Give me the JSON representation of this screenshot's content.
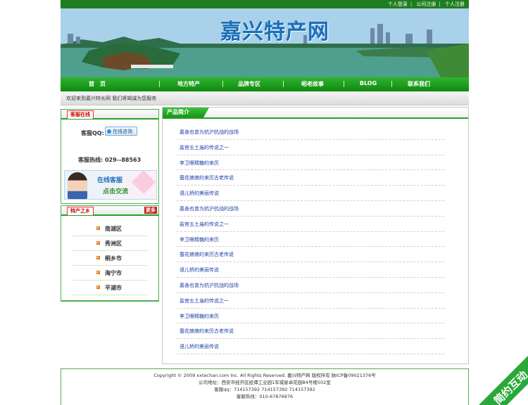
{
  "top_links": [
    "个人登录",
    "公司注册",
    "个人注册"
  ],
  "banner": {
    "title": "嘉兴特产网"
  },
  "nav": {
    "items": [
      "首　页",
      "地方特产",
      "品牌专区",
      "昭老故事",
      "BLOG",
      "联系我们"
    ]
  },
  "welcome": "欢迎来到嘉兴特长网 我们将竭诚为您服务",
  "service": {
    "tab": "客服在线",
    "qq_label": "客服QQ:",
    "qq_button": "在线咨询",
    "hotline": "客服热线: 029--88563",
    "banner_line1": "在线客服",
    "banner_line2": "点击交流"
  },
  "regions": {
    "tab": "特产之乡",
    "more": "更多",
    "items": [
      "南湖区",
      "秀洲区",
      "桐乡市",
      "海宁市",
      "平湖市"
    ]
  },
  "products": {
    "tab": "产品简介",
    "items": [
      "嘉善也曾为抗沪抗战的战场",
      "盐官五土庙的传说之一",
      "李卫眼精糖的来历",
      "蚕花娘娘的来历古老传说",
      "语儿桥的美丽传说",
      "嘉善也曾为抗沪抗战的战场",
      "盐官五土庙的传说之一",
      "李卫眼精糖的来历",
      "蚕花娘娘的来历古老传说",
      "语儿桥的美丽传说",
      "嘉善也曾为抗沪抗战的战场",
      "盐官五土庙的传说之一",
      "李卫眼精糖的来历",
      "蚕花娘娘的来历古老传说",
      "语儿桥的美丽传说"
    ]
  },
  "footer": {
    "line1": "Copyright © 2009 xxtechan.com Inc. All Rights Reserved. 嘉兴特产网 版权所有 陕ICP备09021376号",
    "line2": "公司地址：西安市经开区经谭工业园1车城星卓花园B4号楼502室",
    "line3": "客服qq：714157392 714157392 714157392",
    "line4": "客服热线：010-67876876"
  },
  "watermark": "简约互动"
}
